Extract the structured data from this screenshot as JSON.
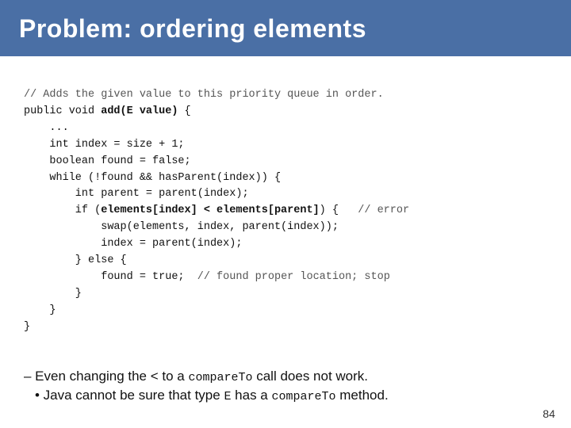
{
  "header": {
    "title": "Problem: ordering elements"
  },
  "code": {
    "comment1": "// Adds the given value to this priority queue in order.",
    "line1": "public void ",
    "line1_bold": "add(E value)",
    "line1_end": " {",
    "line2": "    ...",
    "line3": "    int index = size + 1;",
    "line4": "    boolean found = false;",
    "line5": "    while (!found && hasParent(index)) {",
    "line6": "        int parent = parent(index);",
    "line7_pre": "        if (",
    "line7_bold": "elements[index] < elements[parent]",
    "line7_post": ") {",
    "line7_comment": "   // error",
    "line8": "            swap(elements, index, parent(index));",
    "line9": "            index = parent(index);",
    "line10_pre": "        } else {",
    "line11_pre": "            found = true;",
    "line11_comment": "  // found proper location; stop",
    "line12": "        }",
    "line13": "    }",
    "line14": "}",
    "closing": "}"
  },
  "bottom": {
    "dash_line_pre": "– Even changing the ",
    "dash_lt": "<",
    "dash_line_mid": " to a ",
    "dash_code": "compareTo",
    "dash_line_post": " call does not work.",
    "bullet_pre": "• Java cannot be sure that type ",
    "bullet_code1": "E",
    "bullet_mid": " has a ",
    "bullet_code2": "compareTo",
    "bullet_post": " method."
  },
  "page_number": "84"
}
